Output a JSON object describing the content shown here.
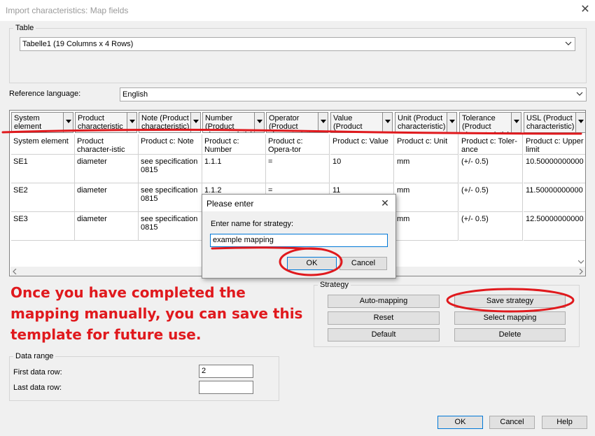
{
  "window": {
    "title": "Import characteristics: Map fields",
    "close_glyph": "✕"
  },
  "table_group": {
    "label": "Table",
    "combo_value": "Tabelle1 (19 Columns x 4 Rows)"
  },
  "reference_language": {
    "label": "Reference language:",
    "value": "English"
  },
  "grid": {
    "headers": [
      "System element [Optional]",
      "Product characteristic",
      "Note (Product characteristic)",
      "Number (Product characteristic)",
      "Operator (Product characteristic)",
      "Value (Product characteristic)",
      "Unit (Product characteristic)",
      "Tolerance (Product characteristic)",
      "USL (Product characteristic)"
    ],
    "rows": [
      [
        "System element",
        "Product character-istic",
        "Product c: Note",
        "Product c: Number",
        "Product c: Opera-tor",
        "Product c: Value",
        "Product c: Unit",
        "Product c: Toler-ance",
        "Product c: Upper limit"
      ],
      [
        "SE1",
        "diameter",
        "see specification 0815",
        "1.1.1",
        "=",
        "10",
        "mm",
        "(+/- 0.5)",
        "10.50000000000"
      ],
      [
        "SE2",
        "diameter",
        "see specification 0815",
        "1.1.2",
        "=",
        "11",
        "mm",
        "(+/- 0.5)",
        "11.50000000000"
      ],
      [
        "SE3",
        "diameter",
        "see specification 0815",
        "",
        "",
        "",
        "mm",
        "(+/- 0.5)",
        "12.50000000000"
      ]
    ]
  },
  "annotation": {
    "text": "Once you have completed the mapping manually, you can save this template for future use."
  },
  "strategy": {
    "label": "Strategy",
    "auto_mapping": "Auto-mapping",
    "save_strategy": "Save strategy",
    "reset": "Reset",
    "select_mapping": "Select mapping",
    "default": "Default",
    "delete": "Delete"
  },
  "data_range": {
    "label": "Data range",
    "first_label": "First data row:",
    "first_value": "2",
    "last_label": "Last data row:",
    "last_value": ""
  },
  "footer": {
    "ok": "OK",
    "cancel": "Cancel",
    "help": "Help"
  },
  "dialog": {
    "title": "Please enter",
    "close_glyph": "✕",
    "prompt": "Enter name for strategy:",
    "input_value": "example mapping",
    "ok": "OK",
    "cancel": "Cancel"
  },
  "colors": {
    "annotation_red": "#e0191d",
    "selection_blue": "#0078d7"
  }
}
